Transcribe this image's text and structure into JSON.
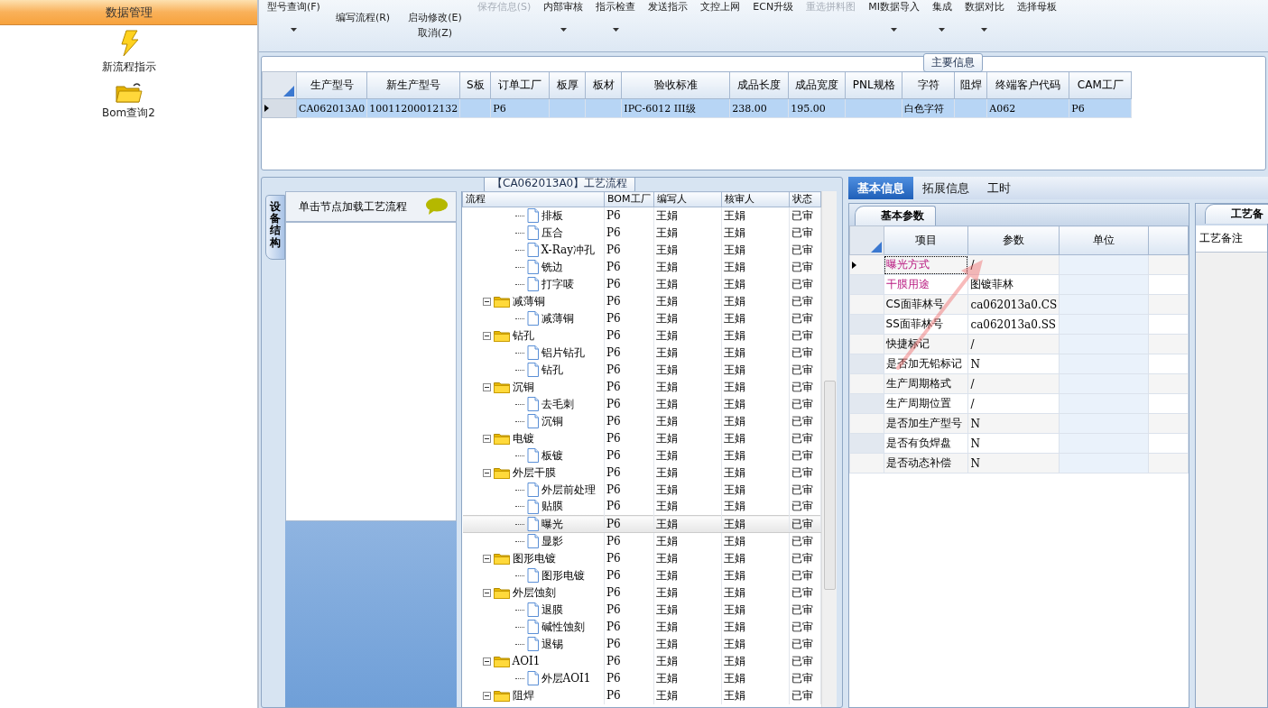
{
  "sidebar": {
    "title": "数据管理",
    "items": [
      {
        "label": "新流程指示"
      },
      {
        "label": "Bom查询2"
      }
    ]
  },
  "toolbar": [
    {
      "kind": "large",
      "label": "型号查询(F)",
      "dropdown": true,
      "disabled": false
    },
    {
      "kind": "stack",
      "items": [
        {
          "label": "编写流程(R)"
        }
      ]
    },
    {
      "kind": "stack",
      "items": [
        {
          "label": "启动修改(E)"
        },
        {
          "label": "取消(Z)"
        }
      ]
    },
    {
      "kind": "large",
      "label": "保存信息(S)",
      "dropdown": false,
      "disabled": true
    },
    {
      "kind": "large",
      "label": "内部审核",
      "dropdown": true,
      "disabled": false
    },
    {
      "kind": "large",
      "label": "指示检查",
      "dropdown": true,
      "disabled": false
    },
    {
      "kind": "large",
      "label": "发送指示",
      "dropdown": false,
      "disabled": false
    },
    {
      "kind": "large",
      "label": "文控上网",
      "dropdown": false,
      "disabled": false
    },
    {
      "kind": "large",
      "label": "ECN升级",
      "dropdown": false,
      "disabled": false
    },
    {
      "kind": "large",
      "label": "重选拼料图",
      "dropdown": false,
      "disabled": true
    },
    {
      "kind": "large",
      "label": "MI数据导入",
      "dropdown": true,
      "disabled": false
    },
    {
      "kind": "large",
      "label": "集成",
      "dropdown": true,
      "disabled": false
    },
    {
      "kind": "large",
      "label": "数据对比",
      "dropdown": true,
      "disabled": false
    },
    {
      "kind": "large",
      "label": "选择母板",
      "dropdown": false,
      "disabled": false
    }
  ],
  "main_info": {
    "title": "主要信息",
    "columns": [
      "生产型号",
      "新生产型号",
      "S板",
      "订单工厂",
      "板厚",
      "板材",
      "验收标准",
      "成品长度",
      "成品宽度",
      "PNL规格",
      "字符",
      "阻焊",
      "终端客户代码",
      "CAM工厂"
    ],
    "rows": [
      {
        "selected": true,
        "cells": [
          "CA062013A0",
          "10011200012132",
          null,
          "P6",
          null,
          null,
          "IPC-6012 III级",
          "238.00",
          "195.00",
          null,
          "白色字符",
          null,
          "A062",
          "P6"
        ]
      }
    ]
  },
  "process": {
    "title": "【CA062013A0】工艺流程",
    "side_tab": "设备结构",
    "hint": "单击节点加载工艺流程",
    "columns": [
      "流程",
      "BOM工厂",
      "编写人",
      "核审人",
      "状态"
    ],
    "nodes": [
      {
        "children": [
          {
            "label": "排板",
            "bom": "P6",
            "writer": "王娟",
            "reviewer": "王娟",
            "status": "已审",
            "selected": false
          },
          {
            "label": "压合",
            "bom": "P6",
            "writer": "王娟",
            "reviewer": "王娟",
            "status": "已审",
            "selected": false
          },
          {
            "label": "X-Ray冲孔",
            "bom": "P6",
            "writer": "王娟",
            "reviewer": "王娟",
            "status": "已审",
            "selected": false
          },
          {
            "label": "铣边",
            "bom": "P6",
            "writer": "王娟",
            "reviewer": "王娟",
            "status": "已审",
            "selected": false
          },
          {
            "label": "打字唛",
            "bom": "P6",
            "writer": "王娟",
            "reviewer": "王娟",
            "status": "已审",
            "selected": false
          }
        ]
      },
      {
        "label": "减薄铜",
        "bom": "P6",
        "writer": "王娟",
        "reviewer": "王娟",
        "status": "已审",
        "selected": false,
        "expanded": true,
        "children": [
          {
            "label": "减薄铜",
            "bom": "P6",
            "writer": "王娟",
            "reviewer": "王娟",
            "status": "已审",
            "selected": false
          }
        ]
      },
      {
        "label": "钻孔",
        "bom": "P6",
        "writer": "王娟",
        "reviewer": "王娟",
        "status": "已审",
        "selected": false,
        "expanded": true,
        "children": [
          {
            "label": "铝片钻孔",
            "bom": "P6",
            "writer": "王娟",
            "reviewer": "王娟",
            "status": "已审",
            "selected": false
          },
          {
            "label": "钻孔",
            "bom": "P6",
            "writer": "王娟",
            "reviewer": "王娟",
            "status": "已审",
            "selected": false
          }
        ]
      },
      {
        "label": "沉铜",
        "bom": "P6",
        "writer": "王娟",
        "reviewer": "王娟",
        "status": "已审",
        "selected": false,
        "expanded": true,
        "children": [
          {
            "label": "去毛刺",
            "bom": "P6",
            "writer": "王娟",
            "reviewer": "王娟",
            "status": "已审",
            "selected": false
          },
          {
            "label": "沉铜",
            "bom": "P6",
            "writer": "王娟",
            "reviewer": "王娟",
            "status": "已审",
            "selected": false
          }
        ]
      },
      {
        "label": "电镀",
        "bom": "P6",
        "writer": "王娟",
        "reviewer": "王娟",
        "status": "已审",
        "selected": false,
        "expanded": true,
        "children": [
          {
            "label": "板镀",
            "bom": "P6",
            "writer": "王娟",
            "reviewer": "王娟",
            "status": "已审",
            "selected": false
          }
        ]
      },
      {
        "label": "外层干膜",
        "bom": "P6",
        "writer": "王娟",
        "reviewer": "王娟",
        "status": "已审",
        "selected": false,
        "expanded": true,
        "children": [
          {
            "label": "外层前处理",
            "bom": "P6",
            "writer": "王娟",
            "reviewer": "王娟",
            "status": "已审",
            "selected": false
          },
          {
            "label": "贴膜",
            "bom": "P6",
            "writer": "王娟",
            "reviewer": "王娟",
            "status": "已审",
            "selected": false
          },
          {
            "label": "曝光",
            "bom": "P6",
            "writer": "王娟",
            "reviewer": "王娟",
            "status": "已审",
            "selected": true
          },
          {
            "label": "显影",
            "bom": "P6",
            "writer": "王娟",
            "reviewer": "王娟",
            "status": "已审",
            "selected": false
          }
        ]
      },
      {
        "label": "图形电镀",
        "bom": "P6",
        "writer": "王娟",
        "reviewer": "王娟",
        "status": "已审",
        "selected": false,
        "expanded": true,
        "children": [
          {
            "label": "图形电镀",
            "bom": "P6",
            "writer": "王娟",
            "reviewer": "王娟",
            "status": "已审",
            "selected": false
          }
        ]
      },
      {
        "label": "外层蚀刻",
        "bom": "P6",
        "writer": "王娟",
        "reviewer": "王娟",
        "status": "已审",
        "selected": false,
        "expanded": true,
        "children": [
          {
            "label": "退膜",
            "bom": "P6",
            "writer": "王娟",
            "reviewer": "王娟",
            "status": "已审",
            "selected": false
          },
          {
            "label": "碱性蚀刻",
            "bom": "P6",
            "writer": "王娟",
            "reviewer": "王娟",
            "status": "已审",
            "selected": false
          },
          {
            "label": "退锡",
            "bom": "P6",
            "writer": "王娟",
            "reviewer": "王娟",
            "status": "已审",
            "selected": false
          }
        ]
      },
      {
        "label": "AOI1",
        "bom": "P6",
        "writer": "王娟",
        "reviewer": "王娟",
        "status": "已审",
        "selected": false,
        "expanded": true,
        "children": [
          {
            "label": "外层AOI1",
            "bom": "P6",
            "writer": "王娟",
            "reviewer": "王娟",
            "status": "已审",
            "selected": false
          }
        ]
      },
      {
        "label": "阻焊",
        "bom": "P6",
        "writer": "王娟",
        "reviewer": "王娟",
        "status": "已审",
        "selected": false,
        "expanded": true
      }
    ]
  },
  "detail": {
    "tabs": [
      {
        "label": "基本信息",
        "selected": true
      },
      {
        "label": "拓展信息",
        "selected": false
      },
      {
        "label": "工时",
        "selected": false
      }
    ],
    "params_tab": "基本参数",
    "columns": [
      "项目",
      "参数",
      "单位"
    ],
    "params": [
      {
        "item": "曝光方式",
        "value": "/",
        "required": true,
        "selected": true
      },
      {
        "item": "干膜用途",
        "value": "图镀菲林",
        "required": true,
        "selected": false
      },
      {
        "item": "CS面菲林号",
        "value": "ca062013a0.CS",
        "required": false,
        "selected": false
      },
      {
        "item": "SS面菲林号",
        "value": "ca062013a0.SS",
        "required": false,
        "selected": false
      },
      {
        "item": "快捷标记",
        "value": "/",
        "required": false,
        "selected": false
      },
      {
        "item": "是否加无铅标记",
        "value": "N",
        "required": false,
        "selected": false
      },
      {
        "item": "生产周期格式",
        "value": "/",
        "required": false,
        "selected": false
      },
      {
        "item": "生产周期位置",
        "value": "/",
        "required": false,
        "selected": false
      },
      {
        "item": "是否加生产型号",
        "value": "N",
        "required": false,
        "selected": false
      },
      {
        "item": "是否有负焊盘",
        "value": "N",
        "required": false,
        "selected": false
      },
      {
        "item": "是否动态补偿",
        "value": "N",
        "required": false,
        "selected": false
      }
    ],
    "remarks_tab": "工艺备",
    "remarks_label": "工艺备注"
  }
}
